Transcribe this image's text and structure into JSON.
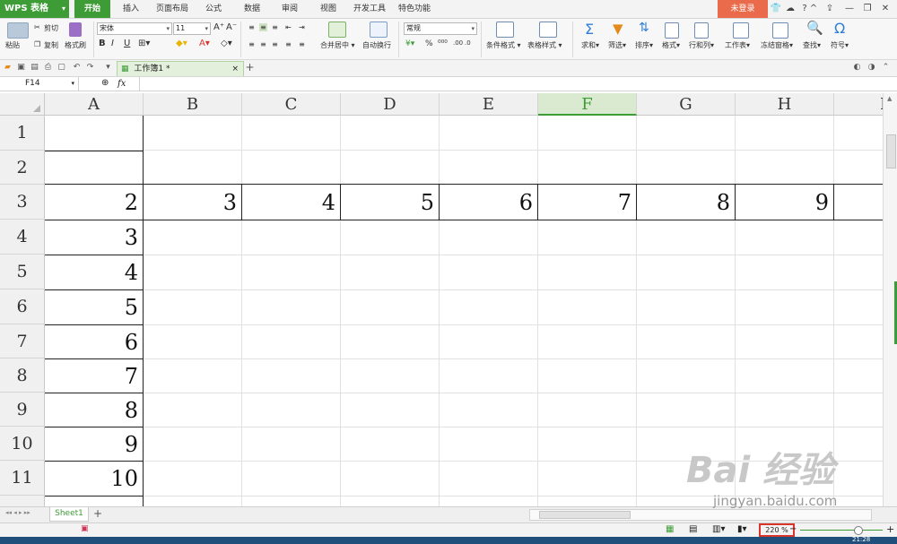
{
  "app": {
    "name": "WPS 表格",
    "login": "未登录"
  },
  "menu_tabs": [
    "开始",
    "插入",
    "页面布局",
    "公式",
    "数据",
    "审阅",
    "视图",
    "开发工具",
    "特色功能"
  ],
  "active_menu_tab": 0,
  "ribbon": {
    "paste": "粘贴",
    "cut": "剪切",
    "copy": "复制",
    "format_painter": "格式刷",
    "font_name": "宋体",
    "font_size": "11",
    "merge_center": "合并居中",
    "wrap_text": "自动换行",
    "number_format": "常规",
    "percent": "%",
    "conditional_format": "条件格式",
    "table_style": "表格样式",
    "sum": "求和",
    "filter": "筛选",
    "sort": "排序",
    "format": "格式",
    "rows_cols": "行和列",
    "worksheet": "工作表",
    "freeze": "冻结窗格",
    "find": "查找",
    "symbol": "符号"
  },
  "document": {
    "tab_title": "工作簿1 *"
  },
  "formula_bar": {
    "name_box": "F14",
    "fx": "fx"
  },
  "grid": {
    "columns": [
      "A",
      "B",
      "C",
      "D",
      "E",
      "F",
      "G",
      "H",
      "I"
    ],
    "active_column": "F",
    "rows": [
      "1",
      "2",
      "3",
      "4",
      "5",
      "6",
      "7",
      "8",
      "9",
      "10",
      "11"
    ],
    "row3": [
      "2",
      "3",
      "4",
      "5",
      "6",
      "7",
      "8",
      "9"
    ],
    "colA_rows4_11": [
      "3",
      "4",
      "5",
      "6",
      "7",
      "8",
      "9",
      "10"
    ]
  },
  "sheet": {
    "name": "Sheet1"
  },
  "status": {
    "zoom": "220 %"
  },
  "watermark": {
    "text": "Bai 经验",
    "sub": "jingyan.baidu.com"
  },
  "clock": "21:28",
  "colors": {
    "accent": "#3d9c36",
    "login": "#e96b4b",
    "highlight": "#d9352c"
  }
}
